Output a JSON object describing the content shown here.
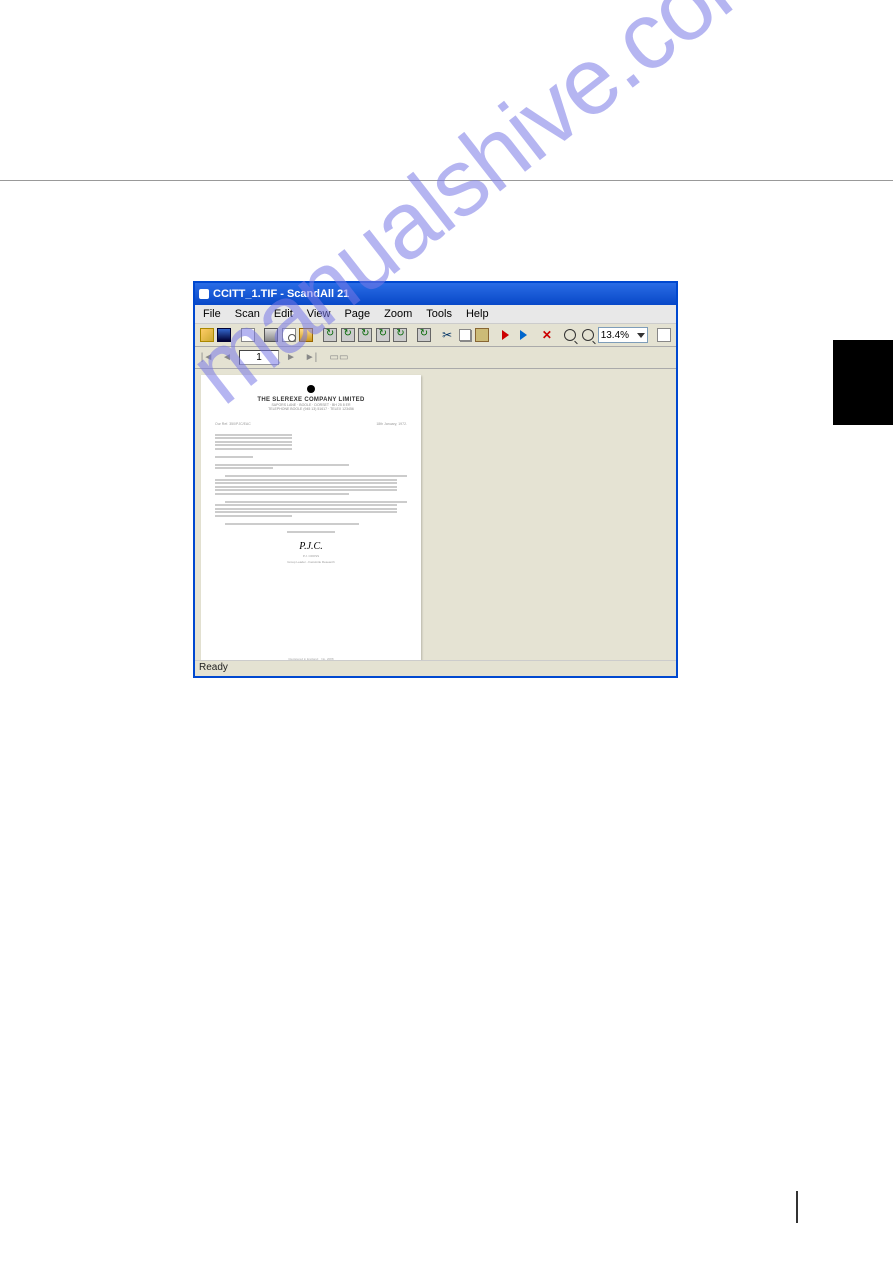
{
  "watermark_text": "manualshive.com",
  "window": {
    "title": "CCITT_1.TIF - ScandAll 21",
    "menu": [
      "File",
      "Scan",
      "Edit",
      "View",
      "Page",
      "Zoom",
      "Tools",
      "Help"
    ],
    "toolbar": {
      "zoom_value": "13.4%"
    },
    "nav": {
      "page": "1"
    },
    "status": "Ready"
  },
  "document": {
    "header": "THE SLEREXE COMPANY LIMITED",
    "ref_left": "Our Ref. 350/PJC/EAC",
    "ref_right": "18th January, 1972.",
    "signature": "P.J.C.",
    "signer": "P.J. CROSS",
    "signer_title": "Group Leader - Facsimile Research"
  }
}
